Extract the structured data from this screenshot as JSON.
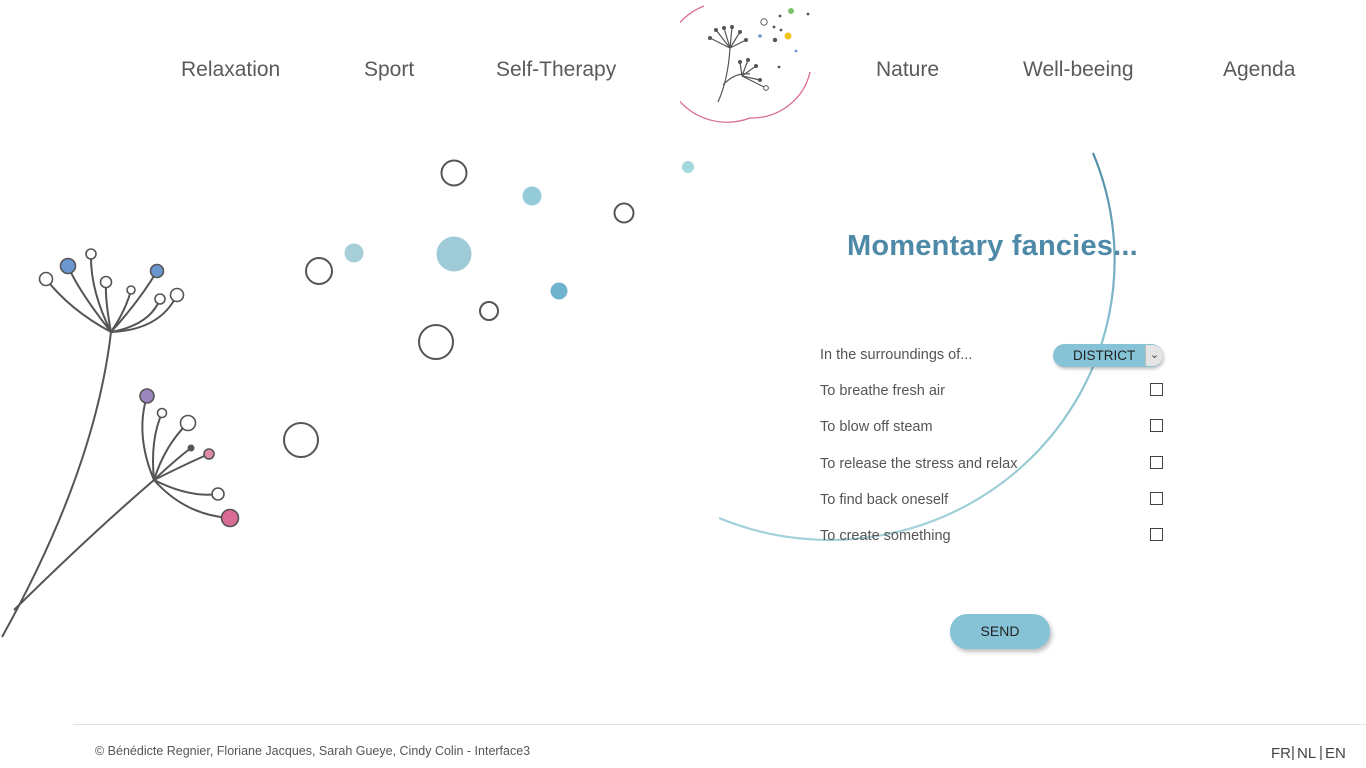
{
  "nav": {
    "items": [
      "Relaxation",
      "Sport",
      "Self-Therapy",
      "Nature",
      "Well-beeing",
      "Agenda"
    ]
  },
  "form": {
    "title": "Momentary fancies...",
    "surroundings_label": "In the surroundings of...",
    "district_value": "DISTRICT",
    "options": [
      "To breathe fresh air",
      "To blow off steam",
      "To release the stress and relax",
      "To find back oneself",
      "To create something"
    ],
    "send_label": "SEND"
  },
  "footer": {
    "copyright": "© Bénédicte Regnier, Floriane Jacques, Sarah Gueye, Cindy Colin - Interface3",
    "languages": [
      "FR",
      "NL",
      "EN"
    ],
    "separator": "|"
  },
  "icons": {
    "logo": "dandelion-logo-icon",
    "select_arrow": "chevron-down-icon"
  },
  "colors": {
    "accent_blue": "#4e8aa8",
    "button_blue": "#86c3d6",
    "pink": "#d96b95",
    "dot_blue": "#6a97cf",
    "dot_purple": "#9b87c0",
    "dot_green": "#7cc26b",
    "dot_yellow": "#f0c21b",
    "light_teal": "#a3cfdc"
  }
}
